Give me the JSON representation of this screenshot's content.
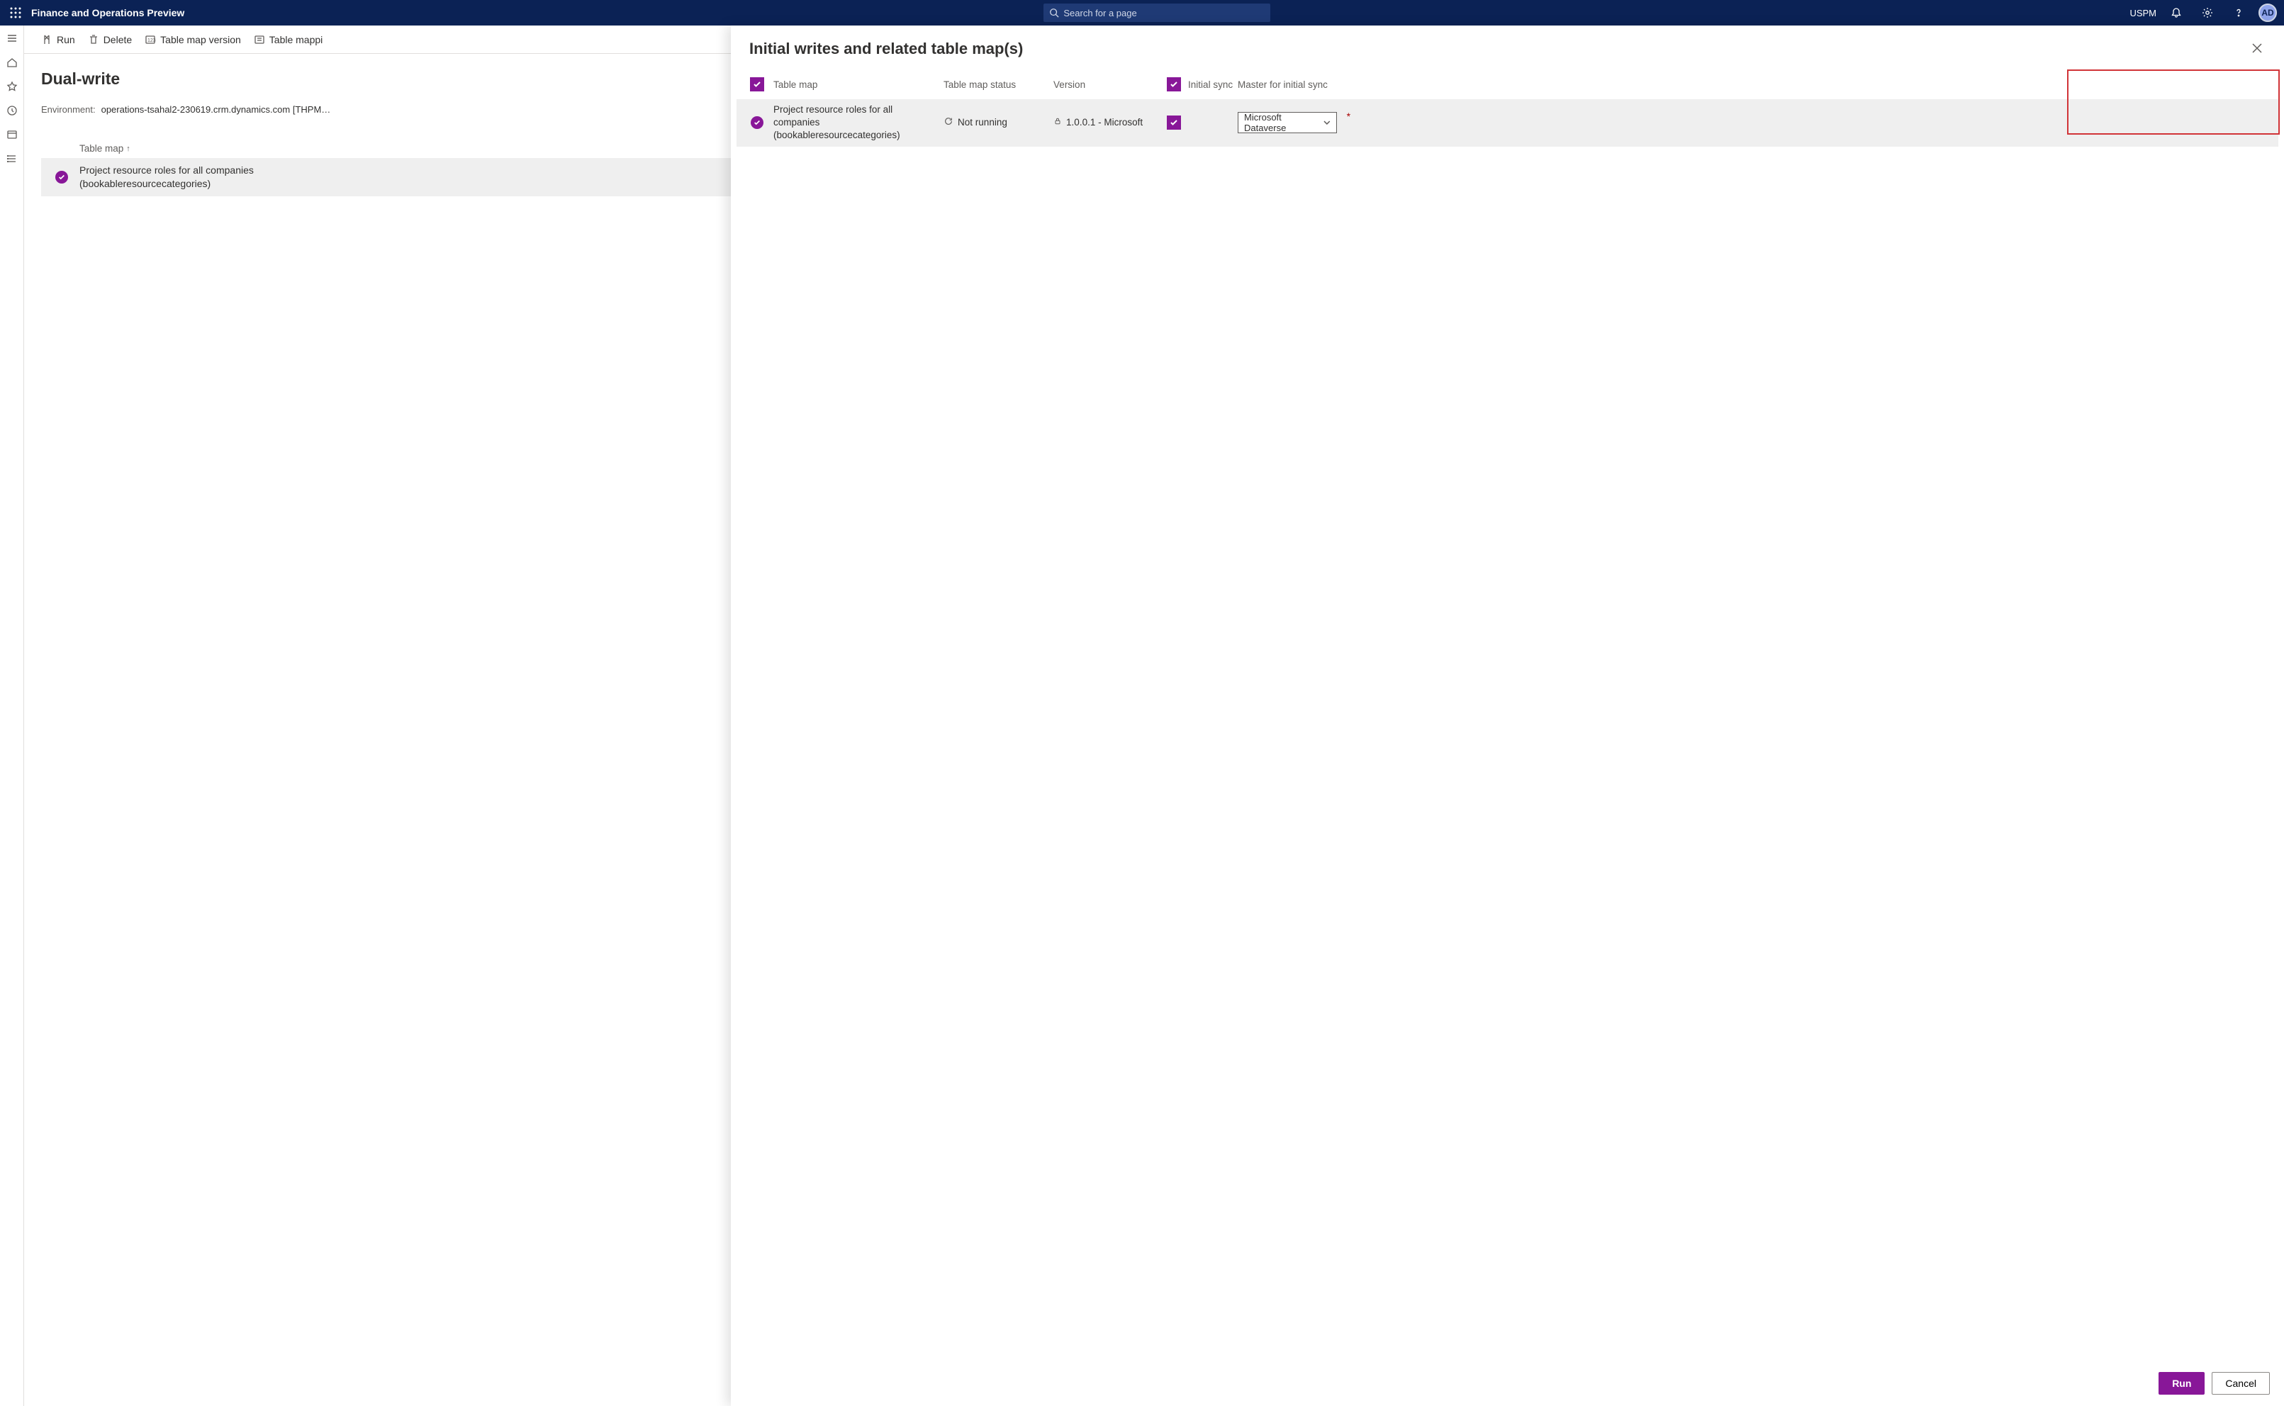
{
  "topbar": {
    "app_title": "Finance and Operations Preview",
    "search_placeholder": "Search for a page",
    "company": "USPM",
    "avatar_initials": "AD"
  },
  "cmdbar": {
    "run": "Run",
    "delete": "Delete",
    "tmv": "Table map version",
    "tmapping": "Table mappi"
  },
  "page": {
    "title": "Dual-write",
    "env_label": "Environment:",
    "env_value": "operations-tsahal2-230619.crm.dynamics.com [THPM…",
    "col_table_map": "Table map",
    "row1_line1": "Project resource roles for all companies",
    "row1_line2": "(bookableresourcecategories)"
  },
  "panel": {
    "title": "Initial writes and related table map(s)",
    "headers": {
      "table_map": "Table map",
      "status": "Table map status",
      "version": "Version",
      "initial_sync": "Initial sync",
      "master": "Master for initial sync"
    },
    "row": {
      "map_line1": "Project resource roles for all companies",
      "map_line2": "(bookableresourcecategories)",
      "status": "Not running",
      "version": "1.0.0.1 - Microsoft",
      "master_selected": "Microsoft Dataverse"
    },
    "footer": {
      "run": "Run",
      "cancel": "Cancel"
    }
  }
}
